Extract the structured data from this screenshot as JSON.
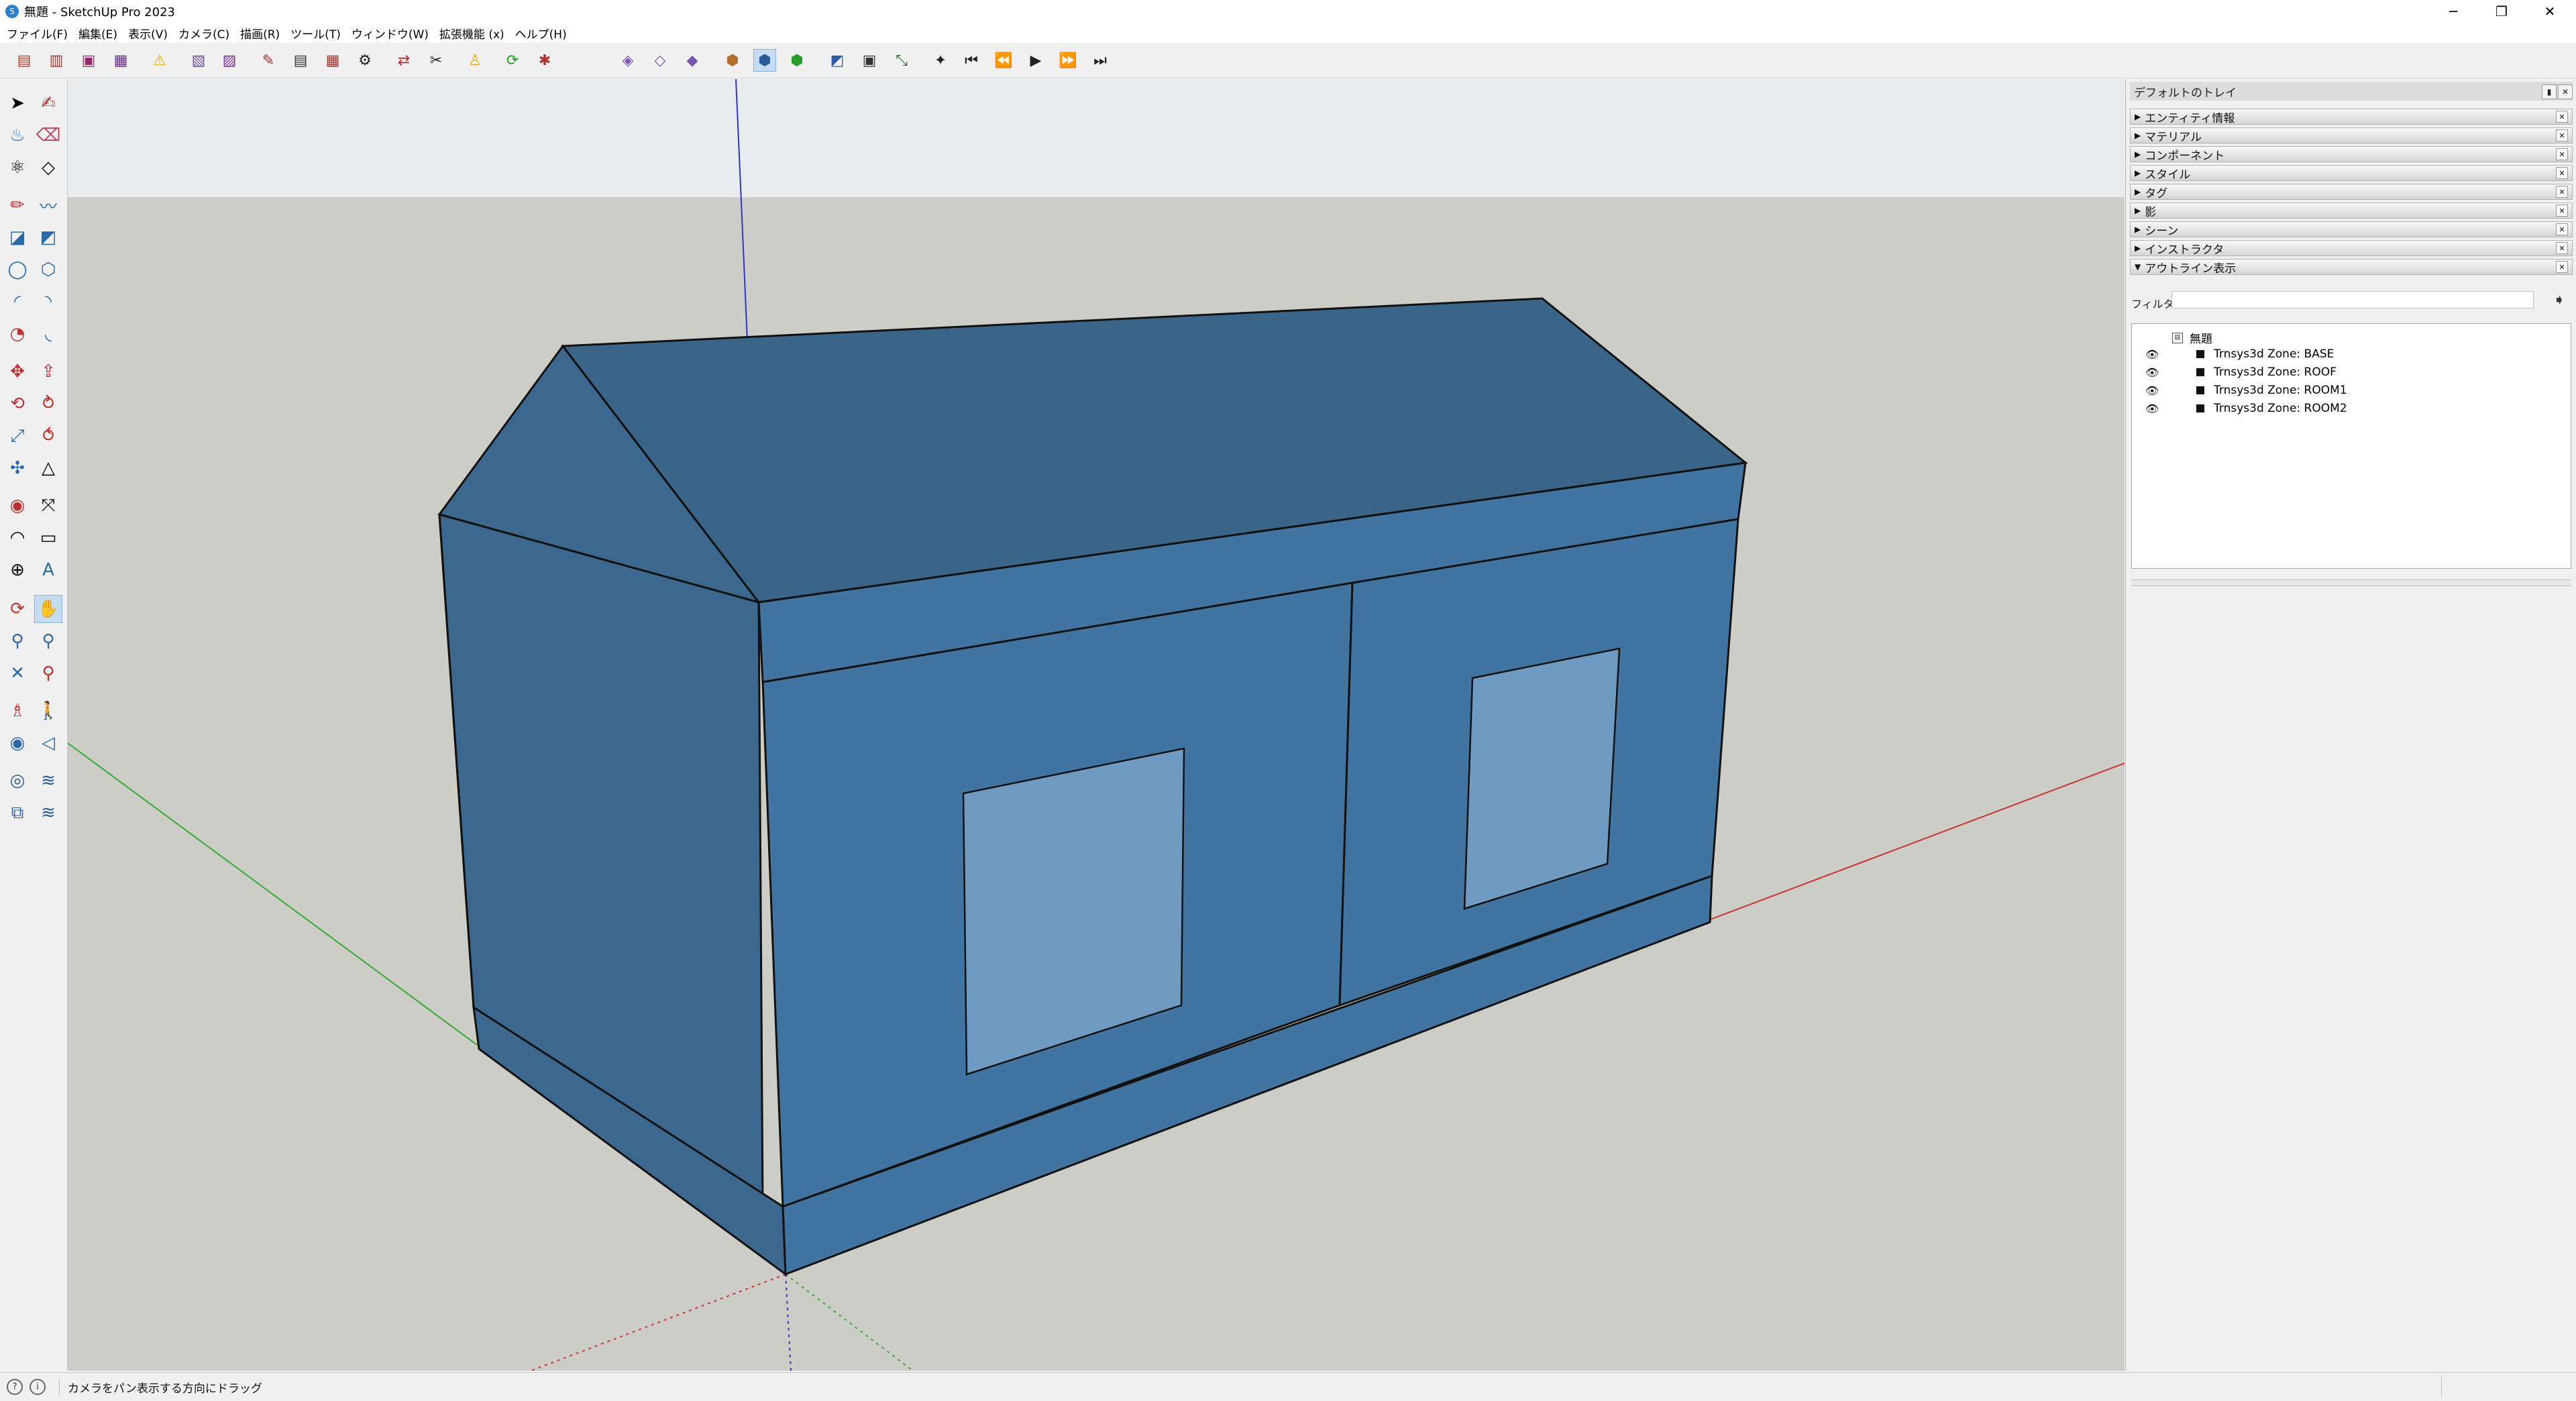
{
  "window": {
    "title": "無題 - SketchUp Pro 2023",
    "app_icon": "sketchup-logo-icon",
    "controls": [
      "─",
      "❐",
      "✕"
    ]
  },
  "menubar": {
    "items": [
      "ファイル(F)",
      "編集(E)",
      "表示(V)",
      "カメラ(C)",
      "描画(R)",
      "ツール(T)",
      "ウィンドウ(W)",
      "拡張機能 (x)",
      "ヘルプ(H)"
    ]
  },
  "tray": {
    "title": "デフォルトのトレイ",
    "panels": [
      {
        "label": "エンティティ情報",
        "expanded": false
      },
      {
        "label": "マテリアル",
        "expanded": false
      },
      {
        "label": "コンポーネント",
        "expanded": false
      },
      {
        "label": "スタイル",
        "expanded": false
      },
      {
        "label": "タグ",
        "expanded": false
      },
      {
        "label": "影",
        "expanded": false
      },
      {
        "label": "シーン",
        "expanded": false
      },
      {
        "label": "インストラクタ",
        "expanded": false
      },
      {
        "label": "アウトライン表示",
        "expanded": true
      }
    ],
    "outliner": {
      "filter_label": "フィルタ:",
      "filter_value": "",
      "root": "無題",
      "entries": [
        "Trnsys3d Zone:  BASE",
        "Trnsys3d Zone:  ROOF",
        "Trnsys3d Zone:  ROOM1",
        "Trnsys3d Zone:  ROOM2"
      ]
    }
  },
  "status": {
    "message": "カメラをパン表示する方向にドラッグ"
  },
  "colors": {
    "viewport_ground": "#cdcdc8",
    "viewport_sky": "#e9ecef",
    "house_face": "#3f6f9c",
    "roof_face": "#3b6489",
    "window_glass": "#6f9bc2",
    "axis_red": "#cc3333",
    "axis_green": "#33aa33",
    "axis_blue": "#3333cc"
  }
}
